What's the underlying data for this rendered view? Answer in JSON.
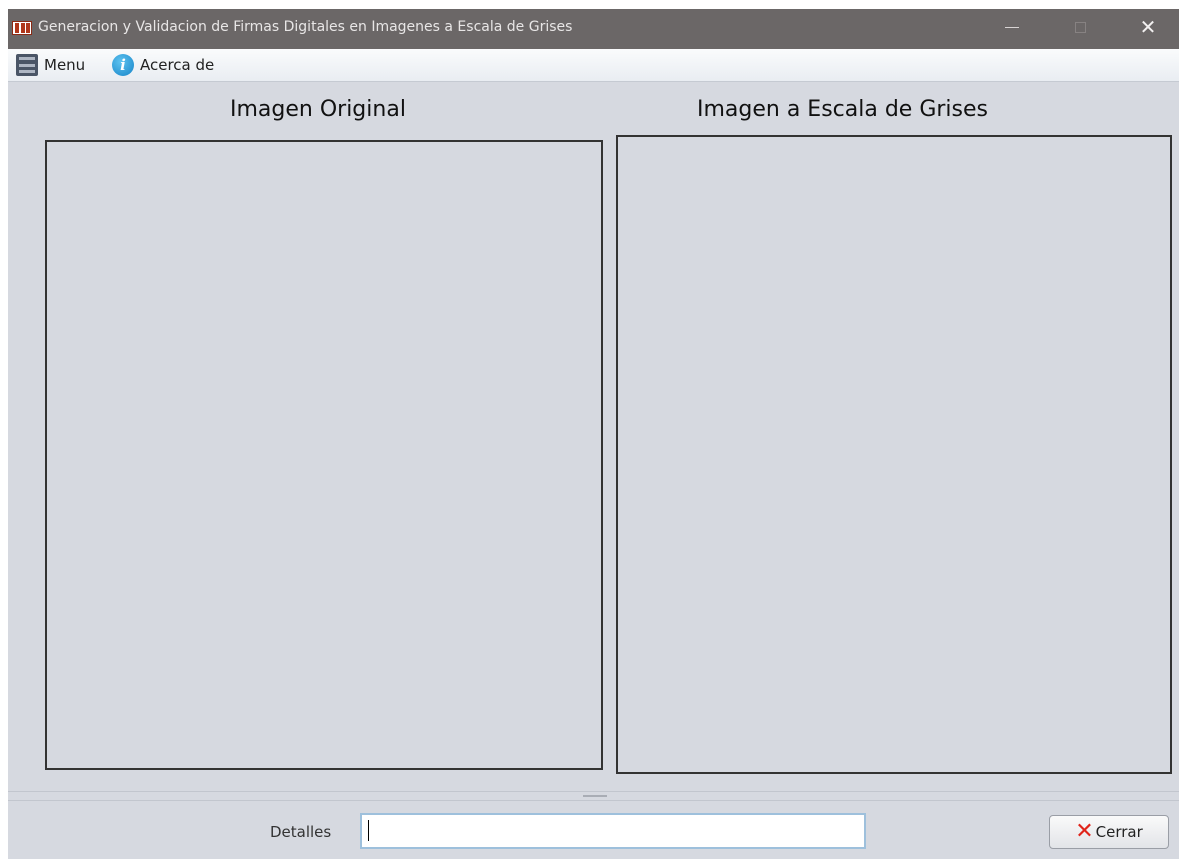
{
  "window": {
    "title": "Generacion y Validacion de Firmas Digitales en Imagenes a Escala de Grises",
    "icon": "app-logo-icon",
    "controls": {
      "minimize": "minimize-icon",
      "maximize": "maximize-icon",
      "close": "close-icon"
    }
  },
  "menubar": {
    "items": [
      {
        "label": "Menu",
        "icon": "hamburger-menu-icon"
      },
      {
        "label": "Acerca de",
        "icon": "info-icon",
        "icon_glyph": "i"
      }
    ]
  },
  "panels": {
    "original_title": "Imagen Original",
    "grayscale_title": "Imagen a Escala de Grises"
  },
  "footer": {
    "details_label": "Detalles",
    "details_value": "",
    "close_button_label": "Cerrar",
    "close_button_glyph": "✕"
  },
  "colors": {
    "titlebar": "#6b6767",
    "background": "#d6d9e0",
    "close_icon": "#e0241a",
    "info_icon": "#1584c8"
  }
}
